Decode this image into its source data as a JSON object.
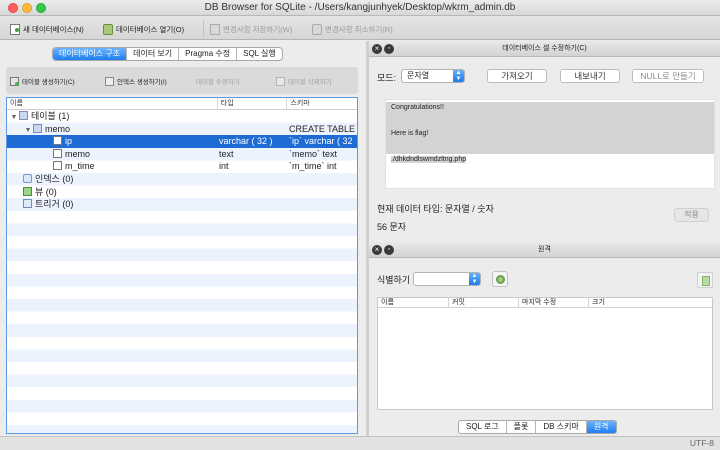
{
  "window": {
    "title": "DB Browser for SQLite - /Users/kangjunhyek/Desktop/wkrm_admin.db"
  },
  "toolbar": {
    "new_db": "새 데이터베이스(N)",
    "open_db": "데이터베이스 열기(O)",
    "write_changes": "변경사항 저장하기(W)",
    "revert_changes": "변경사항 취소하기(R)"
  },
  "left_tabs": [
    "데이터베이스 구조",
    "데이터 보기",
    "Pragma 수정",
    "SQL 실행"
  ],
  "structure_toolbar": {
    "create_table": "테이블 생성하기(C)",
    "create_index": "인덱스 생성하기(I)",
    "modify_table": "테이블 수정하기",
    "delete_table": "테이블 삭제하기"
  },
  "tree": {
    "columns": [
      "이름",
      "타입",
      "스키마"
    ],
    "rows": [
      {
        "name": "테이블 (1)",
        "type": "",
        "schema": ""
      },
      {
        "name": "memo",
        "type": "",
        "schema": "CREATE TABLE"
      },
      {
        "name": "ip",
        "type": "varchar ( 32 )",
        "schema": "`ip` varchar ( 32"
      },
      {
        "name": "memo",
        "type": "text",
        "schema": "`memo` text"
      },
      {
        "name": "m_time",
        "type": "int",
        "schema": "`m_time` int"
      },
      {
        "name": "인덱스 (0)",
        "type": "",
        "schema": ""
      },
      {
        "name": "뷰 (0)",
        "type": "",
        "schema": ""
      },
      {
        "name": "트리거 (0)",
        "type": "",
        "schema": ""
      }
    ]
  },
  "cell_editor": {
    "title": "데이터베이스 셀 수정하기(C)",
    "mode_label": "모드:",
    "mode_value": "문자열",
    "import_button": "가져오기",
    "export_button": "내보내기",
    "set_null_button": "NULL로 만들기",
    "content_lines": [
      "Congratulations!!",
      "",
      "Here is flag!",
      "",
      "./dhkdndlswmdzltng.php"
    ],
    "data_type": "현재 데이터 타입: 문자열 / 숫자",
    "char_count": "56 문자",
    "apply_button": "적용"
  },
  "remote": {
    "title": "원격",
    "identity_label": "식별하기",
    "columns": [
      "이름",
      "커밋",
      "마지막 수정",
      "크기"
    ]
  },
  "bottom_tabs": [
    "SQL 로그",
    "플롯",
    "DB 스키마",
    "원격"
  ],
  "status": {
    "encoding": "UTF-8"
  }
}
